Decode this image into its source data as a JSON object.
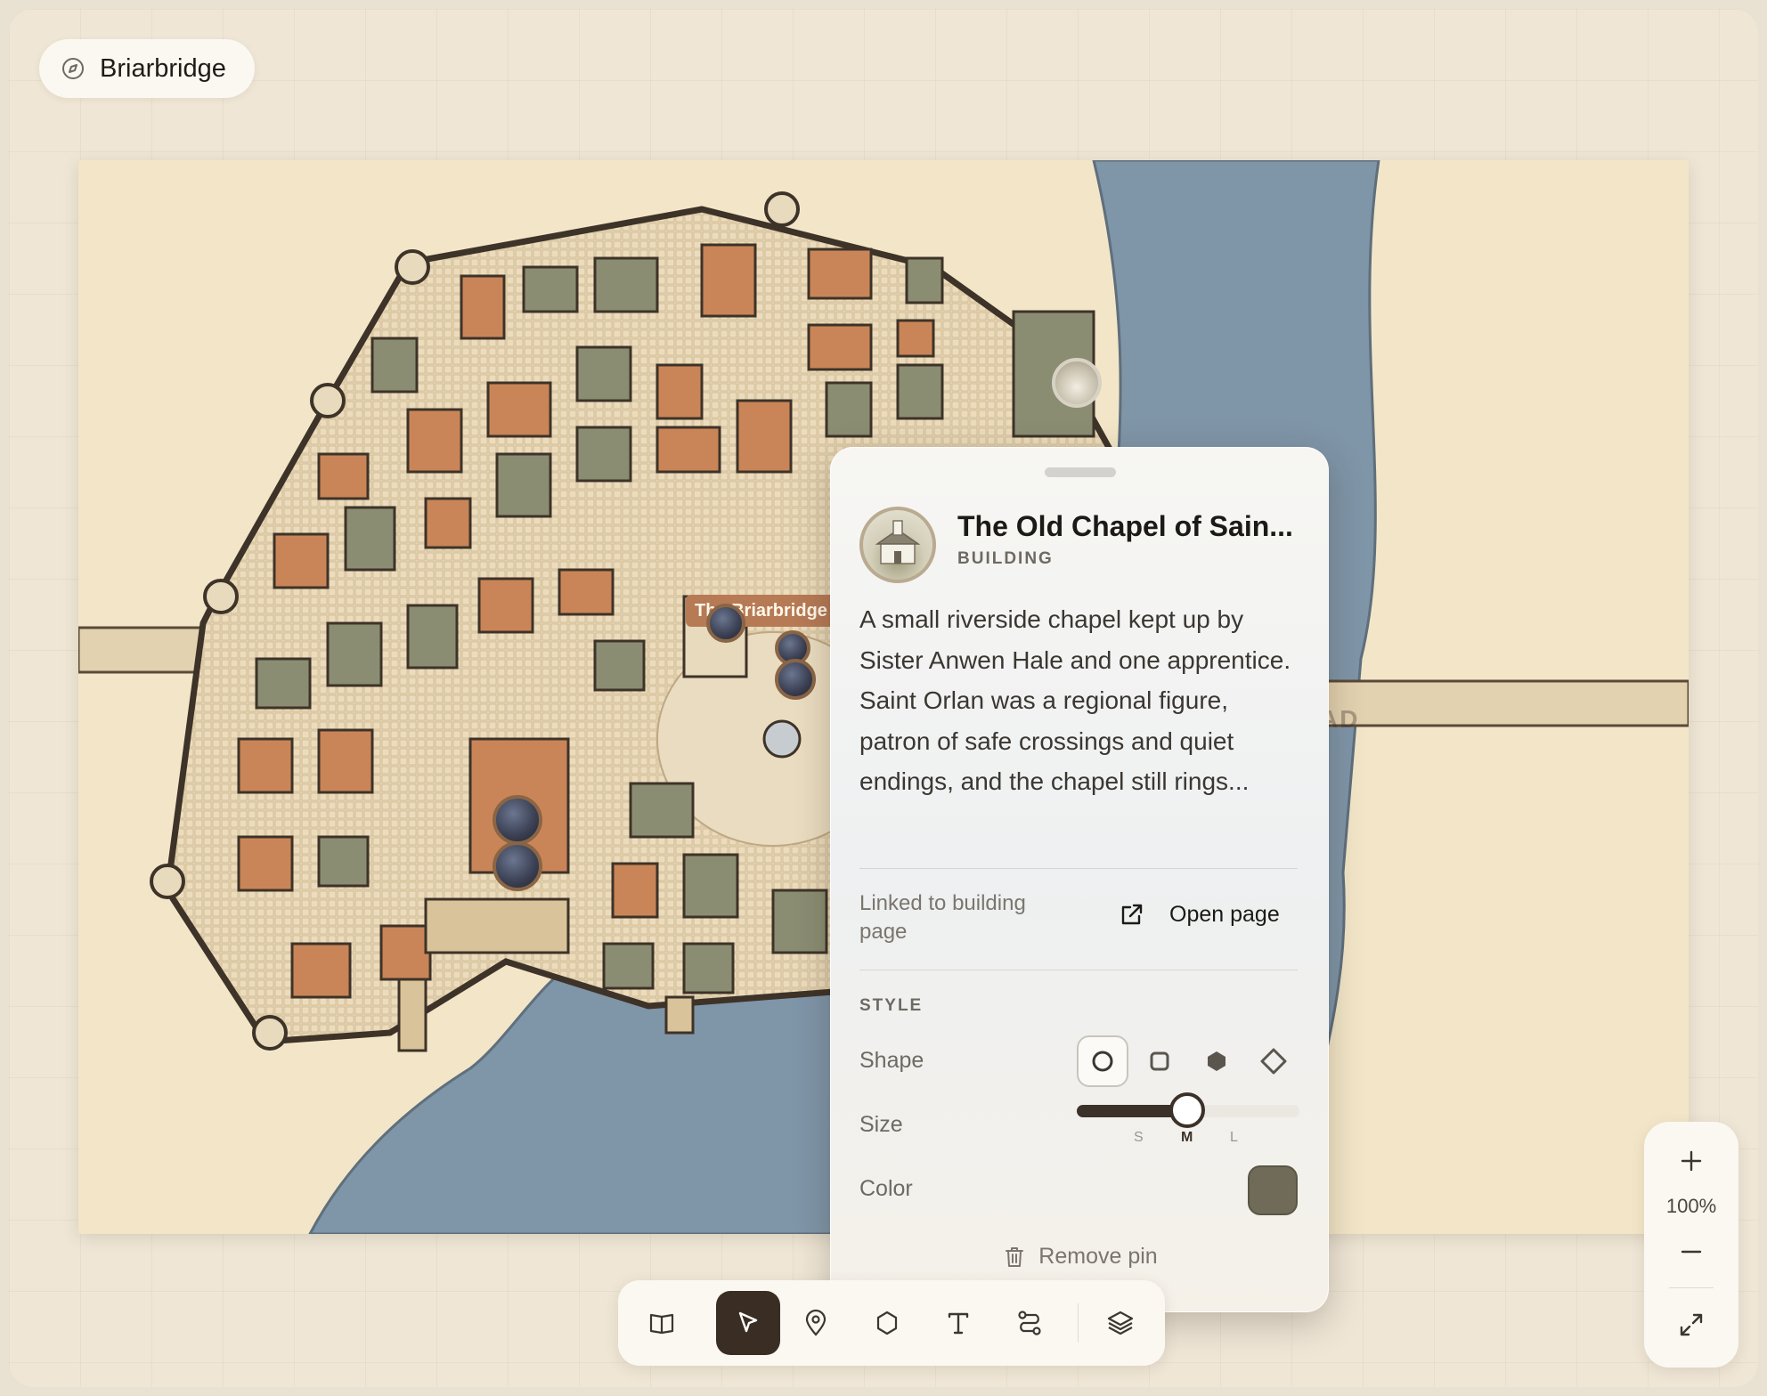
{
  "app": {
    "title": "Briarbridge"
  },
  "map": {
    "label_tavern": "The Briarbridge",
    "label_road": "AD"
  },
  "popover": {
    "title": "The Old Chapel of Sain...",
    "type": "BUILDING",
    "description": "A small riverside chapel kept up by Sister Anwen Hale and one apprentice. Saint Orlan was a regional figure, patron of safe crossings and quiet endings, and the chapel still rings...",
    "linked_text": "Linked to building page",
    "open_page_label": "Open page",
    "style_section": "STYLE",
    "shape_label": "Shape",
    "shape_options": [
      "circle",
      "square",
      "hexagon",
      "diamond"
    ],
    "shape_selected": "circle",
    "size_label": "Size",
    "size_options": [
      "S",
      "M",
      "L"
    ],
    "size_selected": "M",
    "color_label": "Color",
    "color_value": "#6f6b58",
    "remove_label": "Remove pin"
  },
  "toolbar": {
    "tools": [
      "book-icon",
      "select-cursor-icon",
      "map-pin-icon",
      "hexagon-region-icon",
      "text-icon",
      "route-icon",
      "layers-icon"
    ],
    "active_tool": "select-cursor-icon"
  },
  "zoom": {
    "level": "100%"
  },
  "colors": {
    "accent_dark": "#3a2e24",
    "parchment": "#f3e6c8",
    "river": "#7f95a8",
    "roof_orange": "#c98558",
    "roof_green": "#8a8d72"
  }
}
